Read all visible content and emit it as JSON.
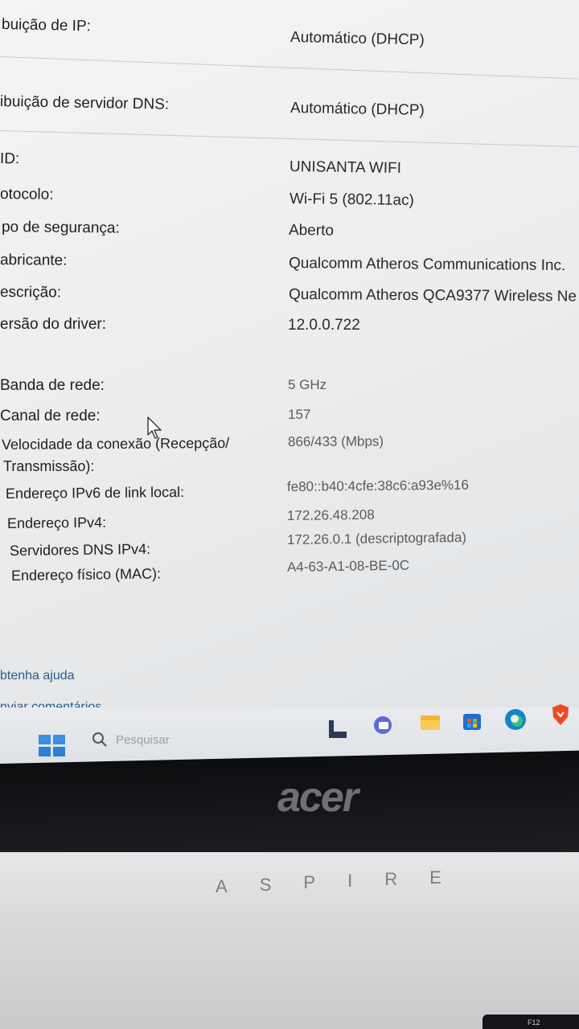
{
  "details": {
    "ip_assign_label": "buição de IP:",
    "ip_assign_value": "Automático (DHCP)",
    "dns_assign_label": "ibuição de servidor DNS:",
    "dns_assign_value": "Automático (DHCP)",
    "ssid_label": "ID:",
    "ssid_value": "UNISANTA WIFI",
    "protocol_label": "otocolo:",
    "protocol_value": "Wi-Fi 5 (802.11ac)",
    "security_label": "po de segurança:",
    "security_value": "Aberto",
    "manufacturer_label": "abricante:",
    "manufacturer_value": "Qualcomm Atheros Communications Inc.",
    "description_label": "escrição:",
    "description_value": "Qualcomm Atheros QCA9377 Wireless Ne",
    "driver_label": "ersão do driver:",
    "driver_value": "12.0.0.722",
    "band_label": "Banda de rede:",
    "band_value": "5 GHz",
    "channel_label": "Canal de rede:",
    "channel_value": "157",
    "speed_label_1": "Velocidade da conexão (Recepção/",
    "speed_label_2": "Transmissão):",
    "speed_value": "866/433 (Mbps)",
    "ipv6_label": "Endereço IPv6 de link local:",
    "ipv6_value": "fe80::b40:4cfe:38c6:a93e%16",
    "ipv4_label": "Endereço IPv4:",
    "ipv4_value": "172.26.48.208",
    "dns_label": "Servidores DNS IPv4:",
    "dns_value": "172.26.0.1 (descriptografada)",
    "mac_label": "Endereço físico (MAC):",
    "mac_value": "A4-63-A1-08-BE-0C"
  },
  "links": {
    "help": "btenha ajuda",
    "feedback": "nviar comentários"
  },
  "taskbar": {
    "search_placeholder": "Pesquisar"
  },
  "hardware": {
    "brand": "acer",
    "model_letters": [
      "A",
      "S",
      "P",
      "I",
      "R",
      "E"
    ],
    "key_label": "F12"
  },
  "colors": {
    "link": "#2b5a8a",
    "accent_blue": "#0a64c8"
  }
}
